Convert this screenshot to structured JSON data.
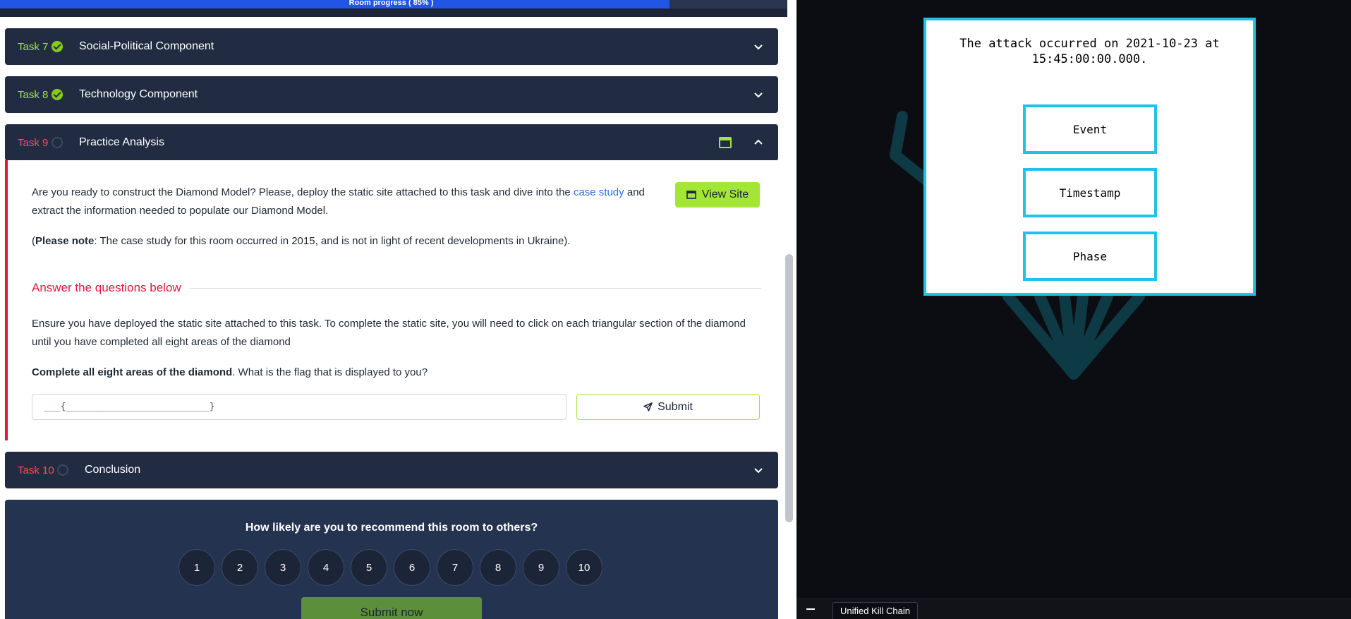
{
  "progress": {
    "label": "Room progress ( 85% )",
    "percent": 85
  },
  "tasks": [
    {
      "number": "Task 7",
      "title": "Social-Political Component",
      "status": "complete",
      "expanded": false
    },
    {
      "number": "Task 8",
      "title": "Technology Component",
      "status": "complete",
      "expanded": false
    },
    {
      "number": "Task 9",
      "title": "Practice Analysis",
      "status": "incomplete",
      "expanded": true
    },
    {
      "number": "Task 10",
      "title": "Conclusion",
      "status": "incomplete",
      "expanded": false
    }
  ],
  "task9": {
    "intro_before_link": "Are you ready to construct the Diamond Model? Please, deploy the static site attached to this task and dive into the ",
    "intro_link": "case study",
    "intro_after_link": " and",
    "intro_line2": "extract the information needed to populate our Diamond Model.",
    "note_open": "(",
    "note_bold": "Please note",
    "note_rest": ": The case study for this room occurred in 2015, and is not in light of recent developments in Ukraine).",
    "view_site_label": "View Site",
    "answer_heading": "Answer the questions below",
    "question_line1": "Ensure you have deployed the static site attached to this task. To complete the static site, you will need to click on each triangular section of the diamond",
    "question_line2": "until you have completed all eight areas of the diamond",
    "q2_bold": "Complete all eight areas of the diamond",
    "q2_rest": ". What is the flag that is displayed to you?",
    "answer_placeholder": "___{__________________________}",
    "submit_label": "Submit"
  },
  "recommend": {
    "question": "How likely are you to recommend this room to others?",
    "ratings": [
      "1",
      "2",
      "3",
      "4",
      "5",
      "6",
      "7",
      "8",
      "9",
      "10"
    ],
    "submit_label": "Submit now"
  },
  "site": {
    "modal_text": "The attack occurred on 2021-10-23 at 15:45:00:00.000.",
    "options": [
      "Event",
      "Timestamp",
      "Phase"
    ],
    "taskbar_tab": "Unified Kill Chain"
  },
  "colors": {
    "accent_green": "#a3e635",
    "task_red": "#ff4a5e",
    "header_navy": "#212c42",
    "progress_blue": "#2155e3",
    "modal_cyan": "#1ec4e8",
    "diamond_teal": "#0e3a45"
  },
  "icons": {
    "complete": "check-circle-icon",
    "incomplete": "empty-circle-icon",
    "expand": "chevron-down-icon",
    "collapse": "chevron-up-icon",
    "site": "browser-window-icon",
    "send": "paper-plane-icon",
    "minimize": "minimize-icon"
  }
}
